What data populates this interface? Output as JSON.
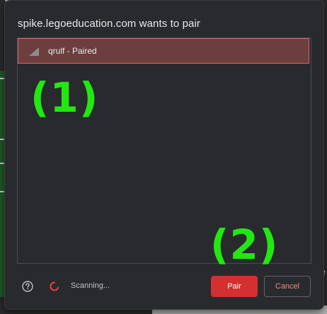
{
  "dialog": {
    "title": "spike.legoeducation.com wants to pair",
    "devices": [
      {
        "label": "qrulf - Paired",
        "icon": "signal-strength-icon",
        "selected": true
      }
    ]
  },
  "annotations": {
    "first": "(1)",
    "second": "(2)",
    "color": "#22e812"
  },
  "footer": {
    "help_icon": "help-circle-icon",
    "spinner_icon": "loading-spinner-icon",
    "status": "Scanning...",
    "pair_label": "Pair",
    "cancel_label": "Cancel"
  },
  "colors": {
    "dialog_bg": "#292a2d",
    "selected_row": "#6c3e3e",
    "accent_red": "#d3302f",
    "cancel_text": "#f28b82"
  }
}
